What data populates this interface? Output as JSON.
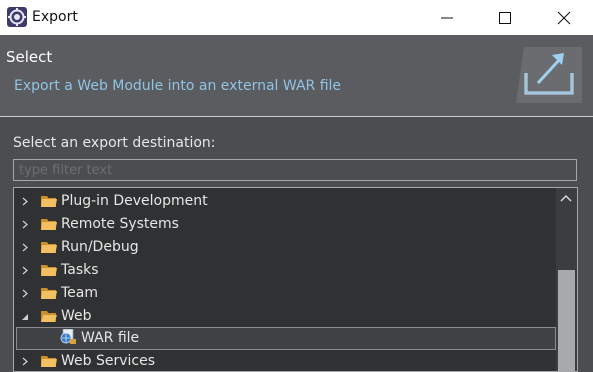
{
  "window": {
    "title": "Export"
  },
  "header": {
    "title": "Select",
    "description": "Export a Web Module into an external WAR file"
  },
  "destination": {
    "label": "Select an export destination:"
  },
  "filter": {
    "placeholder": "type filter text",
    "value": ""
  },
  "tree": {
    "items": [
      {
        "label": "Plug-in Development",
        "expanded": false,
        "level": 0,
        "icon": "folder-icon"
      },
      {
        "label": "Remote Systems",
        "expanded": false,
        "level": 0,
        "icon": "folder-icon"
      },
      {
        "label": "Run/Debug",
        "expanded": false,
        "level": 0,
        "icon": "folder-icon"
      },
      {
        "label": "Tasks",
        "expanded": false,
        "level": 0,
        "icon": "folder-icon"
      },
      {
        "label": "Team",
        "expanded": false,
        "level": 0,
        "icon": "folder-icon"
      },
      {
        "label": "Web",
        "expanded": true,
        "level": 0,
        "icon": "folder-open-icon"
      },
      {
        "label": "WAR file",
        "level": 1,
        "selected": true,
        "icon": "war-file-icon"
      },
      {
        "label": "Web Services",
        "expanded": false,
        "level": 0,
        "icon": "folder-icon"
      }
    ]
  }
}
